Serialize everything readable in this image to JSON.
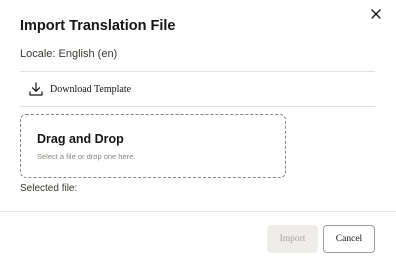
{
  "dialog": {
    "title": "Import Translation File",
    "close_icon": "close-icon",
    "locale_text": "Locale: English (en)",
    "download": {
      "icon": "download-icon",
      "label": "Download Template"
    },
    "dropzone": {
      "title": "Drag and Drop",
      "subtitle": "Select a file or drop one here."
    },
    "selected_file_label": "Selected file:",
    "footer": {
      "import_label": "Import",
      "import_disabled": true,
      "cancel_label": "Cancel"
    }
  }
}
